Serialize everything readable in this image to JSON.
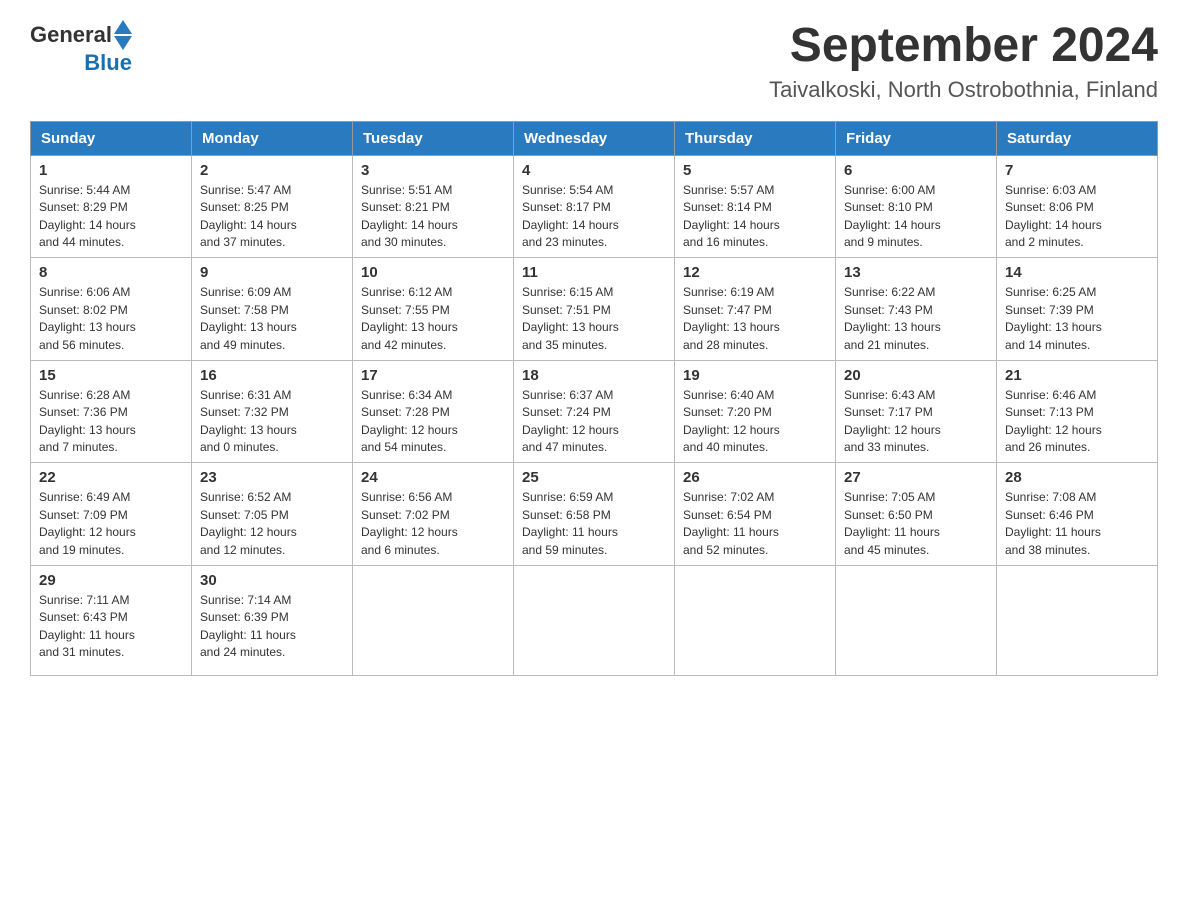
{
  "header": {
    "logo_general": "General",
    "logo_blue": "Blue",
    "title": "September 2024",
    "subtitle": "Taivalkoski, North Ostrobothnia, Finland"
  },
  "days_of_week": [
    "Sunday",
    "Monday",
    "Tuesday",
    "Wednesday",
    "Thursday",
    "Friday",
    "Saturday"
  ],
  "weeks": [
    [
      {
        "day": "1",
        "sunrise": "5:44 AM",
        "sunset": "8:29 PM",
        "daylight": "14 hours and 44 minutes."
      },
      {
        "day": "2",
        "sunrise": "5:47 AM",
        "sunset": "8:25 PM",
        "daylight": "14 hours and 37 minutes."
      },
      {
        "day": "3",
        "sunrise": "5:51 AM",
        "sunset": "8:21 PM",
        "daylight": "14 hours and 30 minutes."
      },
      {
        "day": "4",
        "sunrise": "5:54 AM",
        "sunset": "8:17 PM",
        "daylight": "14 hours and 23 minutes."
      },
      {
        "day": "5",
        "sunrise": "5:57 AM",
        "sunset": "8:14 PM",
        "daylight": "14 hours and 16 minutes."
      },
      {
        "day": "6",
        "sunrise": "6:00 AM",
        "sunset": "8:10 PM",
        "daylight": "14 hours and 9 minutes."
      },
      {
        "day": "7",
        "sunrise": "6:03 AM",
        "sunset": "8:06 PM",
        "daylight": "14 hours and 2 minutes."
      }
    ],
    [
      {
        "day": "8",
        "sunrise": "6:06 AM",
        "sunset": "8:02 PM",
        "daylight": "13 hours and 56 minutes."
      },
      {
        "day": "9",
        "sunrise": "6:09 AM",
        "sunset": "7:58 PM",
        "daylight": "13 hours and 49 minutes."
      },
      {
        "day": "10",
        "sunrise": "6:12 AM",
        "sunset": "7:55 PM",
        "daylight": "13 hours and 42 minutes."
      },
      {
        "day": "11",
        "sunrise": "6:15 AM",
        "sunset": "7:51 PM",
        "daylight": "13 hours and 35 minutes."
      },
      {
        "day": "12",
        "sunrise": "6:19 AM",
        "sunset": "7:47 PM",
        "daylight": "13 hours and 28 minutes."
      },
      {
        "day": "13",
        "sunrise": "6:22 AM",
        "sunset": "7:43 PM",
        "daylight": "13 hours and 21 minutes."
      },
      {
        "day": "14",
        "sunrise": "6:25 AM",
        "sunset": "7:39 PM",
        "daylight": "13 hours and 14 minutes."
      }
    ],
    [
      {
        "day": "15",
        "sunrise": "6:28 AM",
        "sunset": "7:36 PM",
        "daylight": "13 hours and 7 minutes."
      },
      {
        "day": "16",
        "sunrise": "6:31 AM",
        "sunset": "7:32 PM",
        "daylight": "13 hours and 0 minutes."
      },
      {
        "day": "17",
        "sunrise": "6:34 AM",
        "sunset": "7:28 PM",
        "daylight": "12 hours and 54 minutes."
      },
      {
        "day": "18",
        "sunrise": "6:37 AM",
        "sunset": "7:24 PM",
        "daylight": "12 hours and 47 minutes."
      },
      {
        "day": "19",
        "sunrise": "6:40 AM",
        "sunset": "7:20 PM",
        "daylight": "12 hours and 40 minutes."
      },
      {
        "day": "20",
        "sunrise": "6:43 AM",
        "sunset": "7:17 PM",
        "daylight": "12 hours and 33 minutes."
      },
      {
        "day": "21",
        "sunrise": "6:46 AM",
        "sunset": "7:13 PM",
        "daylight": "12 hours and 26 minutes."
      }
    ],
    [
      {
        "day": "22",
        "sunrise": "6:49 AM",
        "sunset": "7:09 PM",
        "daylight": "12 hours and 19 minutes."
      },
      {
        "day": "23",
        "sunrise": "6:52 AM",
        "sunset": "7:05 PM",
        "daylight": "12 hours and 12 minutes."
      },
      {
        "day": "24",
        "sunrise": "6:56 AM",
        "sunset": "7:02 PM",
        "daylight": "12 hours and 6 minutes."
      },
      {
        "day": "25",
        "sunrise": "6:59 AM",
        "sunset": "6:58 PM",
        "daylight": "11 hours and 59 minutes."
      },
      {
        "day": "26",
        "sunrise": "7:02 AM",
        "sunset": "6:54 PM",
        "daylight": "11 hours and 52 minutes."
      },
      {
        "day": "27",
        "sunrise": "7:05 AM",
        "sunset": "6:50 PM",
        "daylight": "11 hours and 45 minutes."
      },
      {
        "day": "28",
        "sunrise": "7:08 AM",
        "sunset": "6:46 PM",
        "daylight": "11 hours and 38 minutes."
      }
    ],
    [
      {
        "day": "29",
        "sunrise": "7:11 AM",
        "sunset": "6:43 PM",
        "daylight": "11 hours and 31 minutes."
      },
      {
        "day": "30",
        "sunrise": "7:14 AM",
        "sunset": "6:39 PM",
        "daylight": "11 hours and 24 minutes."
      },
      null,
      null,
      null,
      null,
      null
    ]
  ]
}
